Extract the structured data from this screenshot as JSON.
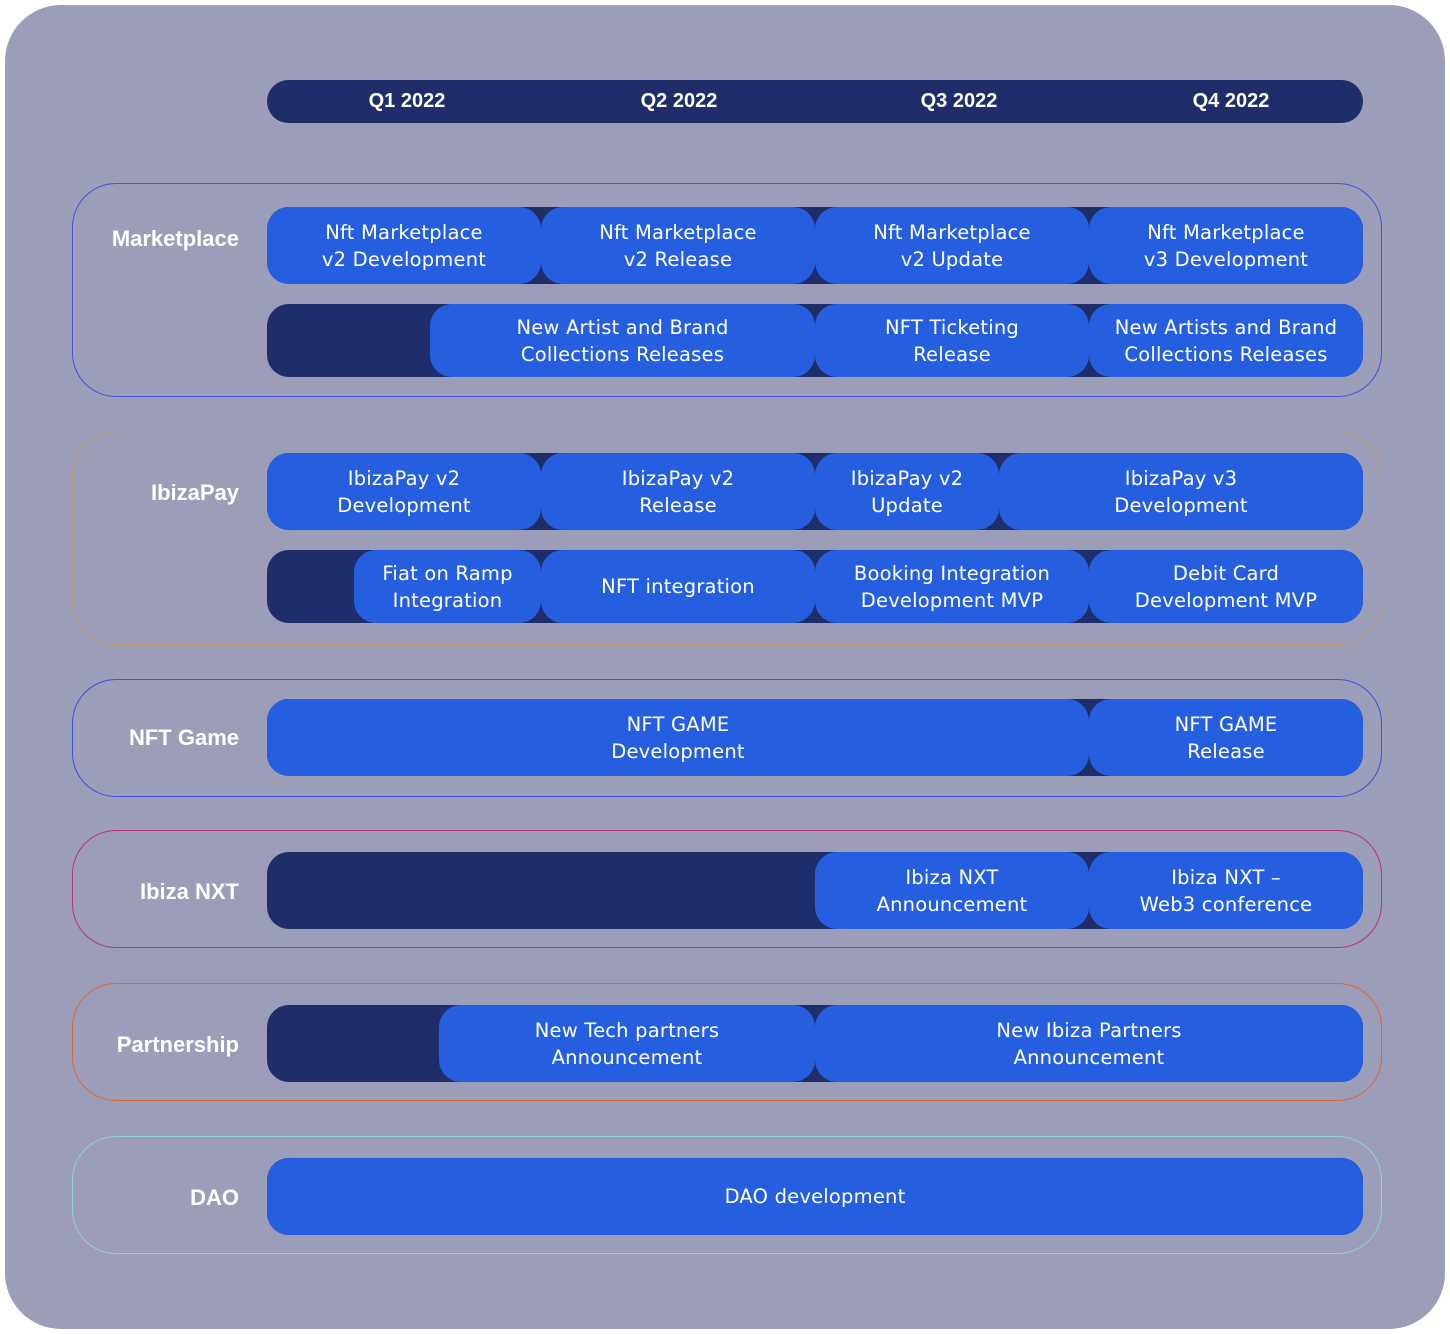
{
  "quarters": [
    "Q1 2022",
    "Q2 2022",
    "Q3 2022",
    "Q4 2022"
  ],
  "sections": [
    {
      "label": "Marketplace",
      "rows": [
        [
          "Nft Marketplace\nv2 Development",
          "Nft Marketplace\nv2 Release",
          "Nft Marketplace\nv2 Update",
          "Nft Marketplace\nv3 Development"
        ],
        [
          "New Artist and Brand\nCollections Releases",
          "NFT Ticketing\nRelease",
          "New Artists and Brand\nCollections Releases"
        ]
      ]
    },
    {
      "label": "IbizaPay",
      "rows": [
        [
          "IbizaPay v2\nDevelopment",
          "IbizaPay v2\nRelease",
          "IbizaPay v2\nUpdate",
          "IbizaPay v3\nDevelopment"
        ],
        [
          "Fiat on Ramp\nIntegration",
          "NFT integration",
          "Booking Integration\nDevelopment MVP",
          "Debit Card\nDevelopment MVP"
        ]
      ]
    },
    {
      "label": "NFT Game",
      "rows": [
        [
          "NFT GAME\nDevelopment",
          "NFT GAME\nRelease"
        ]
      ]
    },
    {
      "label": "Ibiza NXT",
      "rows": [
        [
          "Ibiza NXT\nAnnouncement",
          "Ibiza NXT –\nWeb3 conference"
        ]
      ]
    },
    {
      "label": "Partnership",
      "rows": [
        [
          "New Tech partners\nAnnouncement",
          "New Ibiza Partners\nAnnouncement"
        ]
      ]
    },
    {
      "label": "DAO",
      "rows": [
        [
          "DAO development"
        ]
      ]
    }
  ]
}
